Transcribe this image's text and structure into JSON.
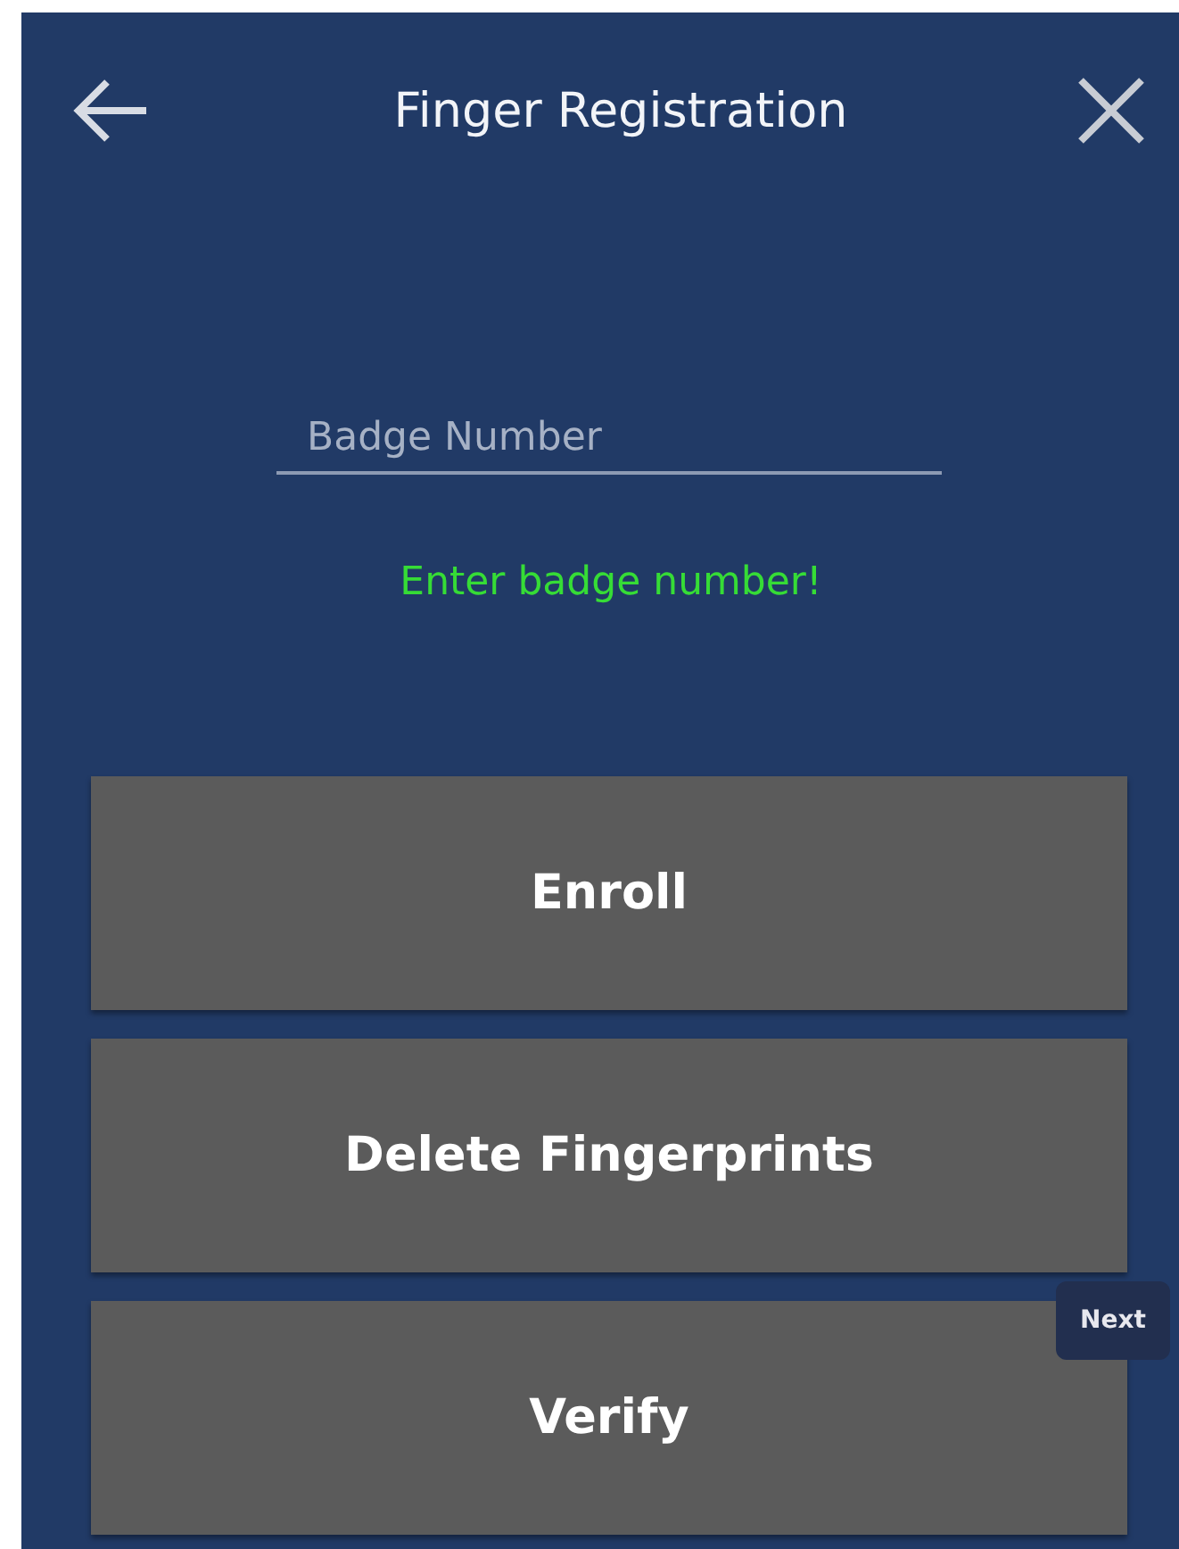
{
  "header": {
    "title": "Finger Registration"
  },
  "badge_field": {
    "placeholder": "Badge Number"
  },
  "message": "Enter badge number!",
  "buttons": [
    "Enroll",
    "Delete Fingerprints",
    "Verify"
  ],
  "tooltip": "Next"
}
